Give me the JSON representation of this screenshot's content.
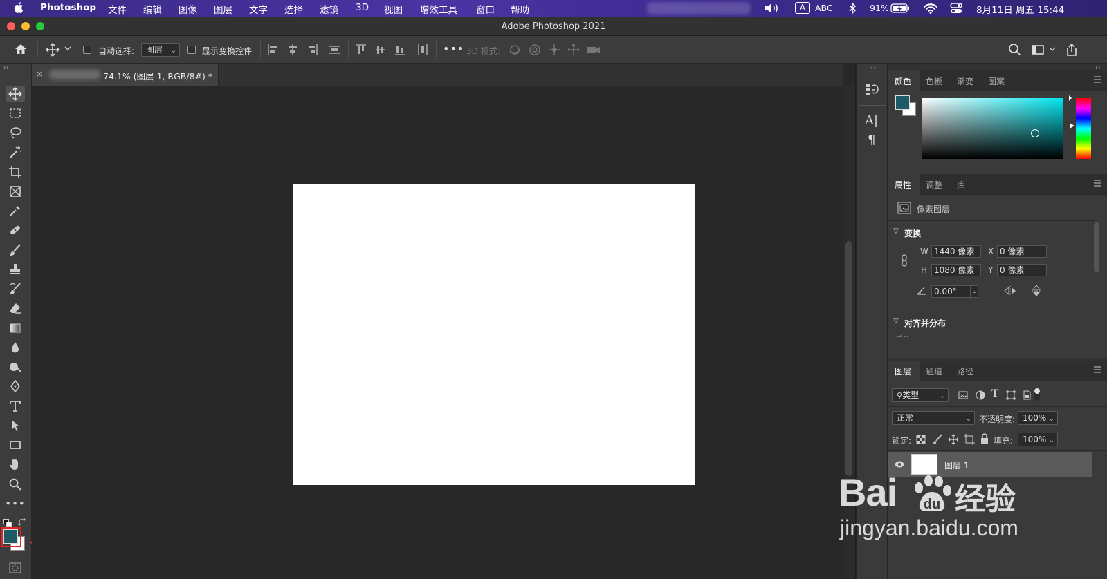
{
  "menubar": {
    "apple_icon": "apple-icon",
    "app_name": "Photoshop",
    "menus": [
      "文件",
      "编辑",
      "图像",
      "图层",
      "文字",
      "选择",
      "滤镜",
      "3D",
      "视图",
      "增效工具",
      "窗口",
      "帮助"
    ],
    "input_mode_badge": "A",
    "input_method": "ABC",
    "battery": "91%",
    "datetime": "8月11日 周五 15:44"
  },
  "window": {
    "title": "Adobe Photoshop 2021"
  },
  "options_bar": {
    "auto_select_label": "自动选择:",
    "auto_select_value": "图层",
    "show_transform_label": "显示变换控件",
    "mode_3d_label": "3D 模式:",
    "more": "•••"
  },
  "document": {
    "tab_close": "×",
    "tab_title": "74.1% (图层 1, RGB/8#) *"
  },
  "toolbar": {
    "more": "•••",
    "foreground_color": "#1f5b66",
    "background_color": "#ffffff"
  },
  "color_panel": {
    "tabs": [
      "颜色",
      "色板",
      "渐变",
      "图案"
    ],
    "foreground": "#1f5b66",
    "hue_color": "#00e5f0"
  },
  "properties_panel": {
    "tabs": [
      "属性",
      "调整",
      "库"
    ],
    "layer_type": "像素图层",
    "transform_header": "变换",
    "w_label": "W",
    "w_value": "1440 像素",
    "x_label": "X",
    "x_value": "0 像素",
    "h_label": "H",
    "h_value": "1080 像素",
    "y_label": "Y",
    "y_value": "0 像素",
    "angle_value": "0.00°",
    "align_header": "对齐并分布",
    "align_sub": "对齐:"
  },
  "layers_panel": {
    "tabs": [
      "图层",
      "通道",
      "路径"
    ],
    "filter_kind": "类型",
    "blend_mode": "正常",
    "opacity_label": "不透明度:",
    "opacity_value": "100%",
    "lock_label": "锁定:",
    "fill_label": "填充:",
    "fill_value": "100%",
    "layer_name": "图层 1"
  },
  "watermark": {
    "brand": "Bai",
    "brand_suffix": "经验",
    "url": "jingyan.baidu.com"
  }
}
